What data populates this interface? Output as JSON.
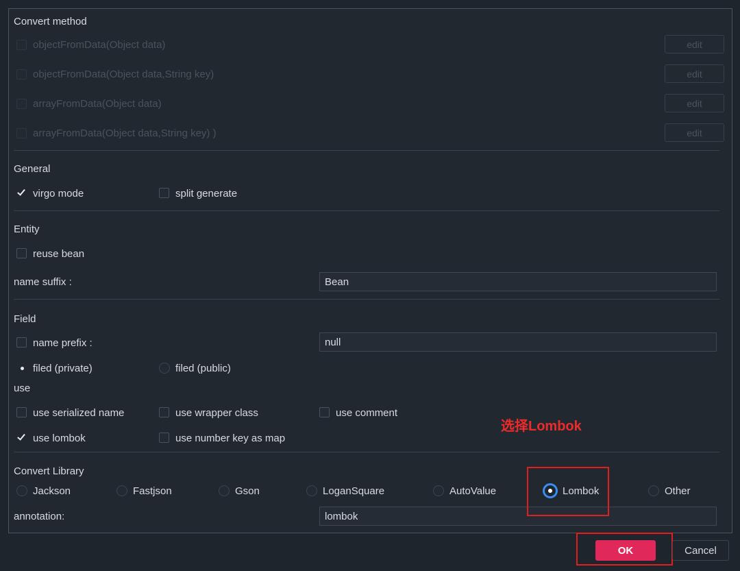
{
  "convert_method": {
    "title": "Convert method",
    "items": [
      {
        "label": "objectFromData(Object data)",
        "button": "edit"
      },
      {
        "label": "objectFromData(Object data,String key)",
        "button": "edit"
      },
      {
        "label": "arrayFromData(Object data)",
        "button": "edit"
      },
      {
        "label": "arrayFromData(Object data,String key) )",
        "button": "edit"
      }
    ]
  },
  "general": {
    "title": "General",
    "virgo_mode": "virgo mode",
    "split_generate": "split generate"
  },
  "entity": {
    "title": "Entity",
    "reuse_bean": "reuse bean",
    "name_suffix_label": "name suffix :",
    "name_suffix_value": "Bean"
  },
  "field": {
    "title": "Field",
    "name_prefix_label": "name prefix :",
    "name_prefix_value": "null",
    "filed_private": "filed (private)",
    "filed_public": "filed (public)",
    "use_title": "use",
    "use_serialized_name": "use serialized name",
    "use_wrapper_class": "use wrapper class",
    "use_comment": "use comment",
    "use_lombok": "use lombok",
    "use_number_key_as_map": "use number key as map"
  },
  "annotation_note": "选择Lombok",
  "convert_library": {
    "title": "Convert Library",
    "options": [
      "Jackson",
      "Fastjson",
      "Gson",
      "LoganSquare",
      "AutoValue",
      "Lombok",
      "Other"
    ],
    "selected": "Lombok",
    "annotation_label": "annotation:",
    "annotation_value": "lombok"
  },
  "footer": {
    "ok": "OK",
    "cancel": "Cancel"
  },
  "colors": {
    "background": "#1f252d",
    "accent_ok": "#e0285b",
    "highlight": "#e02020",
    "radio_selected": "#3a8ef0"
  }
}
